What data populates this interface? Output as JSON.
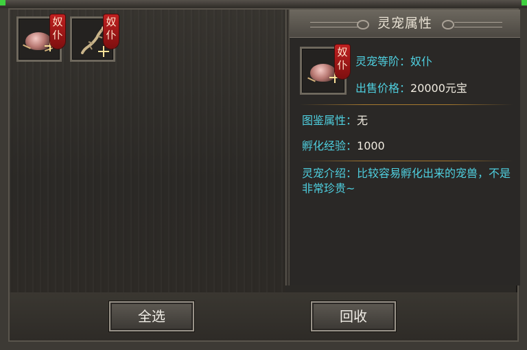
{
  "pets": [
    {
      "badge": [
        "奴",
        "仆"
      ],
      "icon": "beetle-icon"
    },
    {
      "badge": [
        "奴",
        "仆"
      ],
      "icon": "lizard-icon"
    }
  ],
  "detail": {
    "title": "灵宠属性",
    "badge": [
      "奴",
      "仆"
    ],
    "icon": "beetle-icon",
    "rank_label": "灵宠等阶：",
    "rank_value": "奴仆",
    "price_label": "出售价格：",
    "price_value": "20000元宝",
    "collection_label": "图鉴属性：",
    "collection_value": "无",
    "hatch_exp_label": "孵化经验：",
    "hatch_exp_value": "1000",
    "intro_label": "灵宠介绍：",
    "intro_text": "比较容易孵化出来的宠兽，不是非常珍贵~"
  },
  "buttons": {
    "select_all": "全选",
    "recycle": "回收"
  },
  "colors": {
    "label_cyan": "#4fd0e0",
    "badge_red": "#b01818"
  }
}
